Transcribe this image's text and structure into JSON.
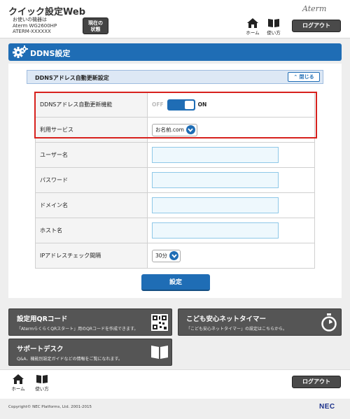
{
  "header": {
    "app_title": "クイック設定Web",
    "device_line1": "お使いの機器は",
    "device_line2": "Aterm WG2600HP",
    "device_line3": "ATERM-XXXXXX",
    "status_line1": "現在の",
    "status_line2": "状態",
    "brand": "Aterm",
    "home_label": "ホーム",
    "howto_label": "使い方",
    "logout_label": "ログアウト"
  },
  "page": {
    "title": "DDNS設定"
  },
  "section": {
    "title": "DDNSアドレス自動更新設定",
    "close_label": "閉じる"
  },
  "form": {
    "auto_update_label": "DDNSアドレス自動更新機能",
    "toggle_off": "OFF",
    "toggle_on": "ON",
    "service_label": "利用サービス",
    "service_value": "お名前.com",
    "username_label": "ユーザー名",
    "username_value": "",
    "password_label": "パスワード",
    "password_value": "",
    "domain_label": "ドメイン名",
    "domain_value": "",
    "host_label": "ホスト名",
    "host_value": "",
    "interval_label": "IPアドレスチェック間隔",
    "interval_value": "30分",
    "submit_label": "設定"
  },
  "tiles": {
    "qr_title": "設定用QRコード",
    "qr_desc": "「AtermらくらくQRスタート」用のQRコードを作成できます。",
    "timer_title": "こども安心ネットタイマー",
    "timer_desc": "「こども安心ネットタイマー」の設定はこちらから。",
    "support_title": "サポートデスク",
    "support_desc": "Q&A、機能別設定ガイドなどの情報をご覧になれます。"
  },
  "footer": {
    "home_label": "ホーム",
    "howto_label": "使い方",
    "logout_label": "ログアウト",
    "copyright": "Copyright© NEC Platforms, Ltd. 2001-2015",
    "nec_logo": "NEC"
  },
  "colors": {
    "accent": "#1f6db5",
    "highlight": "#d7211d",
    "tile": "#555555"
  }
}
